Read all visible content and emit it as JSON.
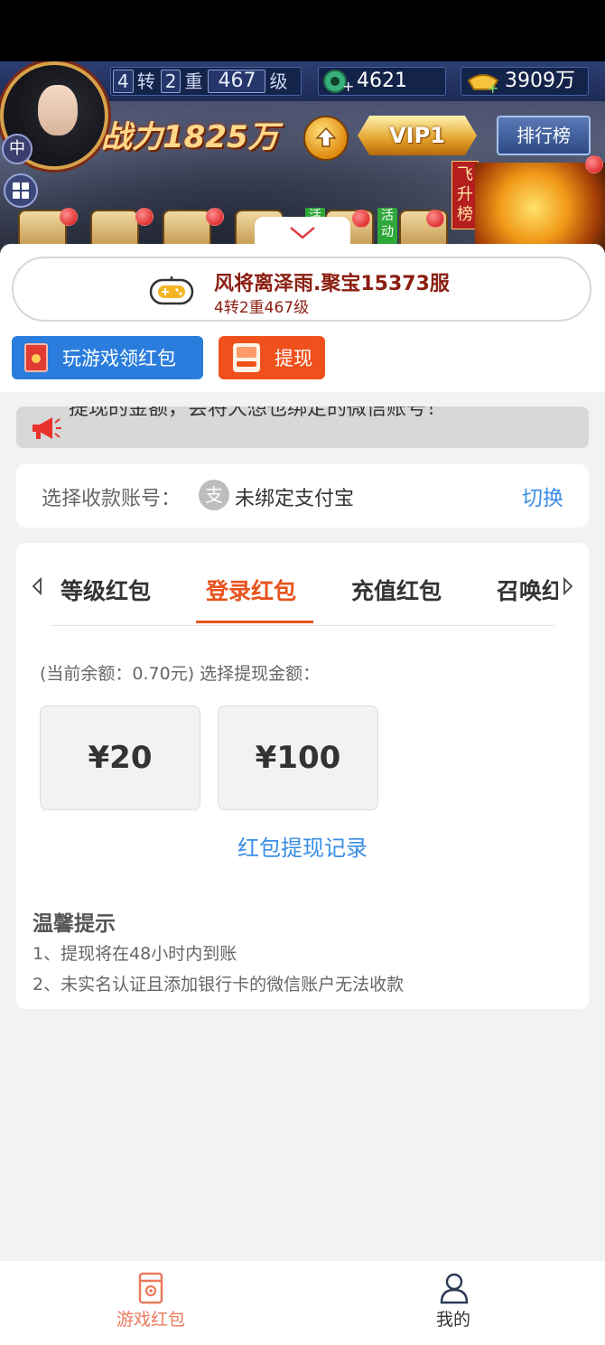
{
  "game_hud": {
    "zhuan": "4",
    "zhuan_label": "转",
    "chong": "2",
    "chong_label": "重",
    "level": "467",
    "level_label": "级",
    "jade": "4621",
    "gold": "3909万",
    "avatar_badge": "中",
    "combat_power": "战力1825万",
    "vip": "VIP1",
    "rank_button": "排行榜",
    "feisheng_label": "飞升榜",
    "activity_tag_1": "活动",
    "activity_tag_2": "活动"
  },
  "server": {
    "name": "风将离泽雨.聚宝15373服",
    "level_info": "4转2重467级"
  },
  "actions": {
    "play_game_label": "玩游戏领红包",
    "withdraw_label": "提现"
  },
  "notice": {
    "text": "提现的金额，会将大想也绑定的微信账号！"
  },
  "account": {
    "label": "选择收款账号：",
    "alipay_glyph": "支",
    "value": "未绑定支付宝",
    "switch_label": "切换"
  },
  "tabs": [
    {
      "label": "等级红包"
    },
    {
      "label": "登录红包"
    },
    {
      "label": "充值红包"
    },
    {
      "label": "召唤红包"
    }
  ],
  "withdraw": {
    "balance_text": "(当前余额：0.70元) 选择提现金额：",
    "options": [
      "¥20",
      "¥100"
    ],
    "record_link": "红包提现记录"
  },
  "tips": {
    "title": "温馨提示",
    "lines": [
      "1、提现将在48小时内到账",
      "2、未实名认证且添加银行卡的微信账户无法收款"
    ]
  },
  "bottom_nav": [
    {
      "label": "游戏红包",
      "icon": "redpacket-icon",
      "active": true
    },
    {
      "label": "我的",
      "icon": "user-icon",
      "active": false
    }
  ],
  "colors": {
    "accent": "#e8531d",
    "link": "#3a8ee6",
    "primary_button": "#2a7ddc",
    "withdraw_button": "#f0501c",
    "server_text": "#8b1f12"
  }
}
